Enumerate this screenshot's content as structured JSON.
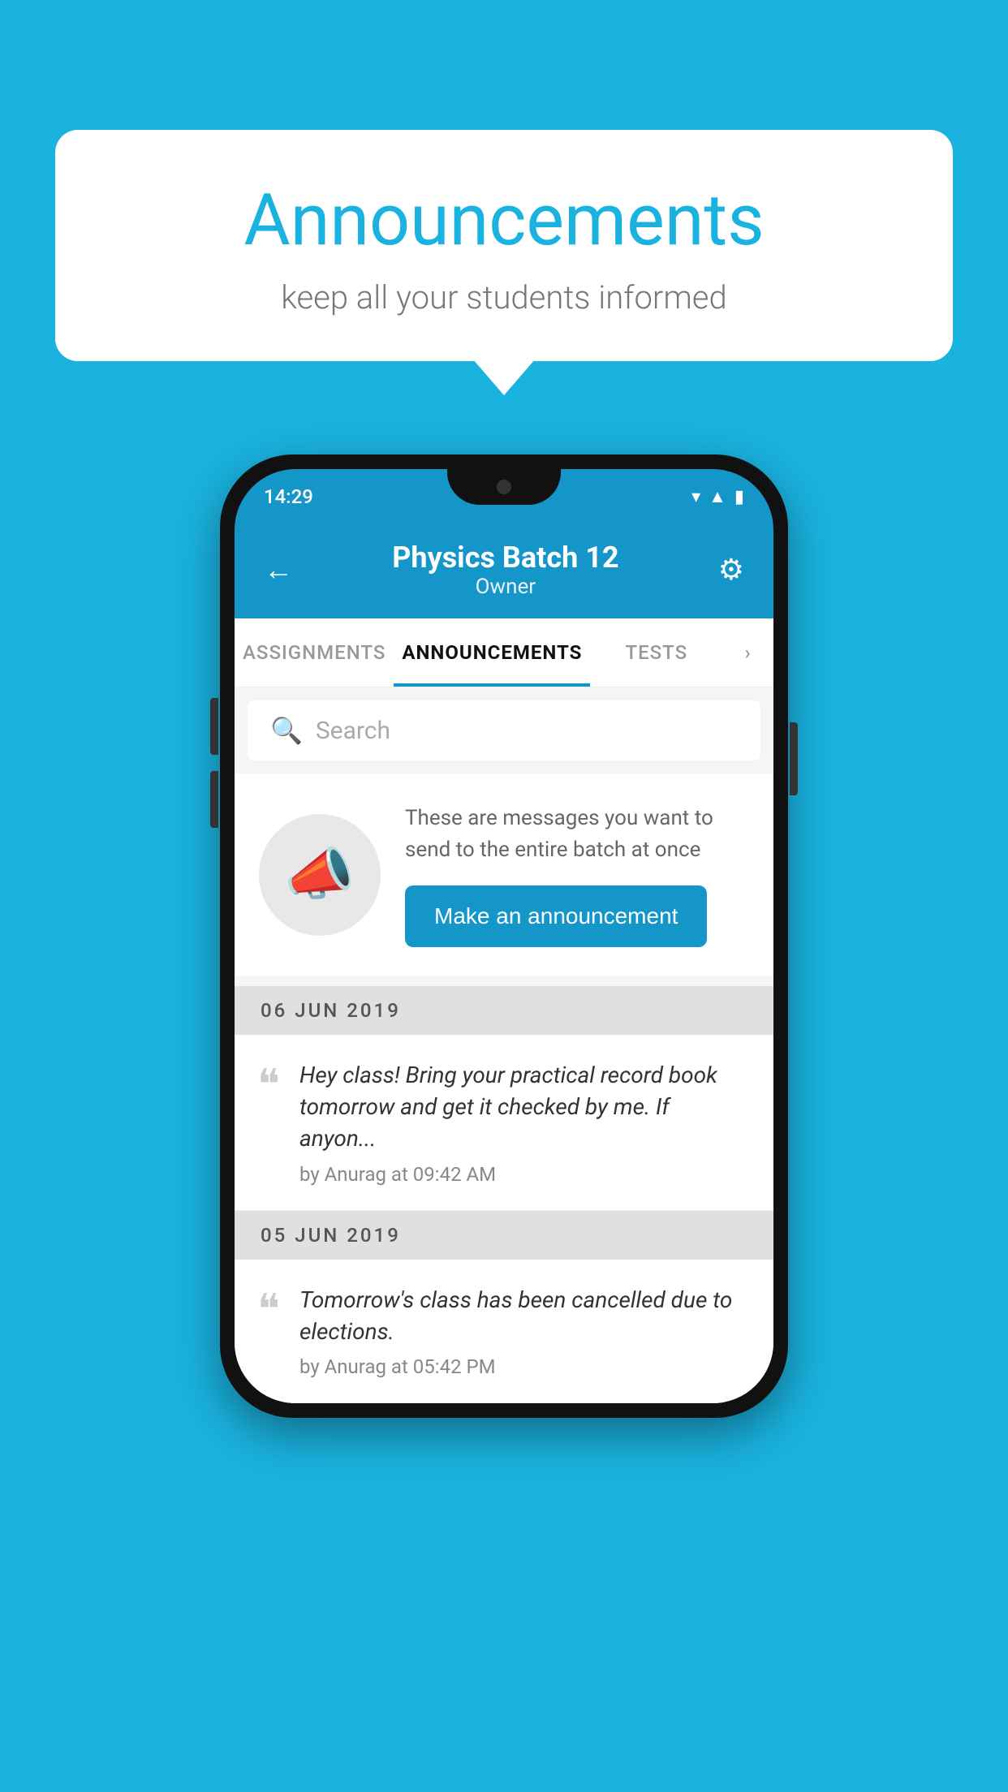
{
  "bubble": {
    "title": "Announcements",
    "subtitle": "keep all your students informed"
  },
  "phone": {
    "status": {
      "time": "14:29",
      "icons": [
        "wifi",
        "signal",
        "battery"
      ]
    },
    "header": {
      "title": "Physics Batch 12",
      "subtitle": "Owner",
      "back_label": "←",
      "gear_label": "⚙"
    },
    "tabs": [
      {
        "label": "ASSIGNMENTS",
        "active": false
      },
      {
        "label": "ANNOUNCEMENTS",
        "active": true
      },
      {
        "label": "TESTS",
        "active": false
      },
      {
        "label": "›",
        "active": false
      }
    ],
    "search": {
      "placeholder": "Search"
    },
    "prompt": {
      "text": "These are messages you want to send to the entire batch at once",
      "button_label": "Make an announcement"
    },
    "announcements": [
      {
        "date": "06  JUN  2019",
        "text": "Hey class! Bring your practical record book tomorrow and get it checked by me. If anyon...",
        "meta": "by Anurag at 09:42 AM"
      },
      {
        "date": "05  JUN  2019",
        "text": "Tomorrow's class has been cancelled due to elections.",
        "meta": "by Anurag at 05:42 PM"
      }
    ]
  }
}
